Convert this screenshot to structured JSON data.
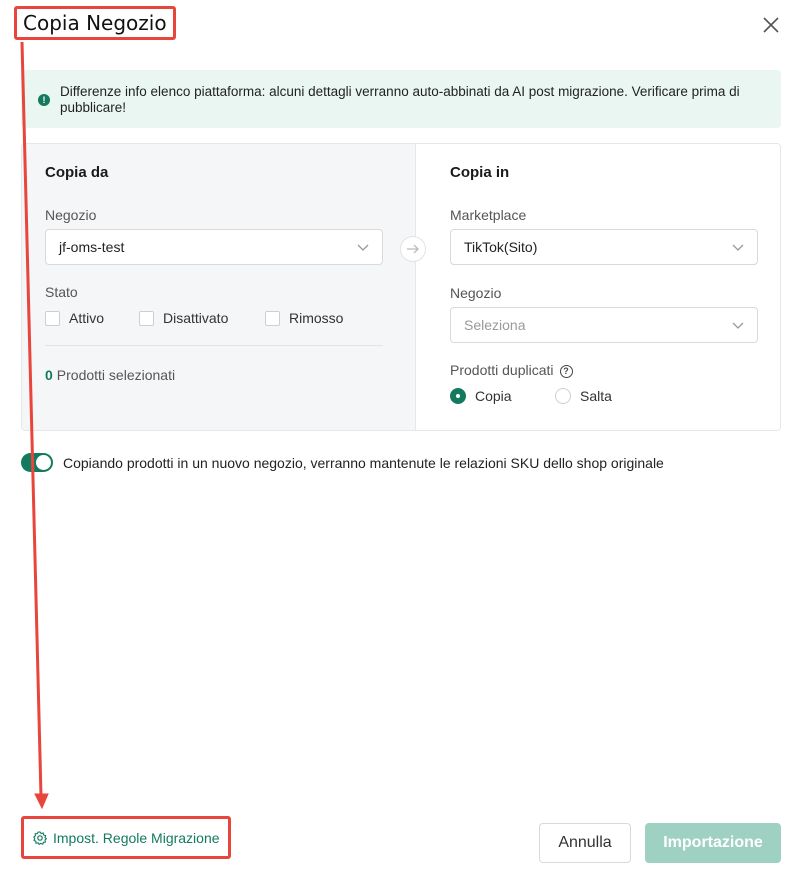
{
  "dialog": {
    "title": "Copia Negozio"
  },
  "alert": {
    "text": "Differenze info elenco piattaforma: alcuni dettagli verranno auto-abbinati da AI post migrazione. Verificare prima di pubblicare!"
  },
  "copy_from": {
    "title": "Copia da",
    "store_label": "Negozio",
    "store_value": "jf-oms-test",
    "status_label": "Stato",
    "status_options": [
      {
        "label": "Attivo",
        "checked": false
      },
      {
        "label": "Disattivato",
        "checked": false
      },
      {
        "label": "Rimosso",
        "checked": false
      }
    ],
    "selected_count": "0",
    "selected_label": "Prodotti selezionati"
  },
  "copy_to": {
    "title": "Copia in",
    "marketplace_label": "Marketplace",
    "marketplace_value": "TikTok(Sito)",
    "store_label": "Negozio",
    "store_placeholder": "Seleziona",
    "duplicates_label": "Prodotti duplicati",
    "duplicate_options": [
      {
        "label": "Copia",
        "checked": true
      },
      {
        "label": "Salta",
        "checked": false
      }
    ]
  },
  "sku_toggle": {
    "enabled": true,
    "label": "Copiando prodotti in un nuovo negozio, verranno mantenute le relazioni SKU dello shop originale"
  },
  "footer": {
    "rules_link": "Impost. Regole Migrazione",
    "cancel_label": "Annulla",
    "import_label": "Importazione"
  },
  "colors": {
    "accent": "#137a5f",
    "annotation": "#e8453c",
    "alert_bg": "#eaf6f2",
    "import_disabled": "#9fd1c3"
  },
  "icons": [
    "close-icon",
    "info-icon",
    "chevron-down-icon",
    "arrow-right-icon",
    "help-icon",
    "gear-icon"
  ]
}
